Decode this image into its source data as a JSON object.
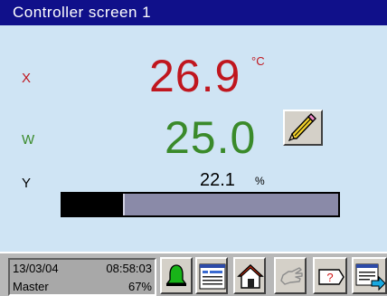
{
  "title": "Controller screen 1",
  "process": {
    "x": {
      "label": "X",
      "value": "26.9",
      "unit": "°C",
      "color": "#c0161e"
    },
    "w": {
      "label": "W",
      "value": "25.0",
      "color": "#3a8a2a"
    },
    "y": {
      "label": "Y",
      "value": "22.1",
      "unit": "%",
      "output_percent": 22.1
    }
  },
  "edit_button": {
    "icon": "pencil-icon"
  },
  "status": {
    "date": "13/03/04",
    "time": "08:58:03",
    "user": "Master",
    "load": "67%"
  },
  "toolbar": [
    {
      "icon": "alarm-bell-icon"
    },
    {
      "icon": "list-view-icon"
    },
    {
      "icon": "home-icon"
    },
    {
      "icon": "hand-icon",
      "disabled": true
    },
    {
      "icon": "help-tag-icon"
    },
    {
      "icon": "next-screen-icon"
    }
  ]
}
